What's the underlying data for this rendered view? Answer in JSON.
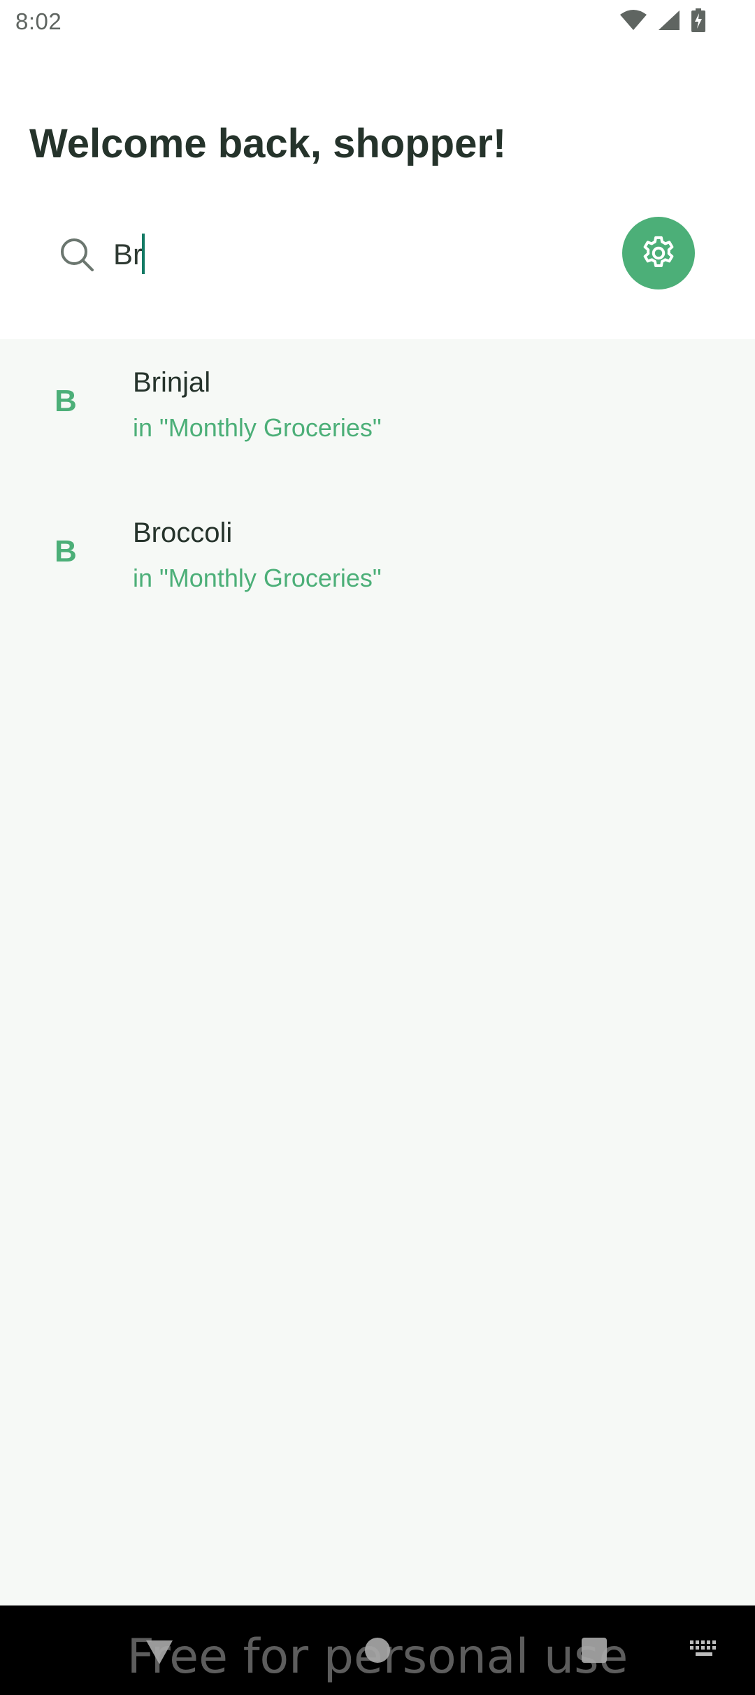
{
  "status_bar": {
    "time": "8:02",
    "icons": [
      "wifi-icon",
      "signal-icon",
      "battery-charging-icon"
    ]
  },
  "header": {
    "greeting": "Welcome back, shopper!"
  },
  "search": {
    "value": "Br",
    "icon": "search-icon",
    "settings_icon": "gear-icon"
  },
  "results": [
    {
      "initial": "B",
      "name": "Brinjal",
      "list": "in \"Monthly Groceries\""
    },
    {
      "initial": "B",
      "name": "Broccoli",
      "list": "in \"Monthly Groceries\""
    }
  ],
  "nav_bar": {
    "icons": [
      "back-icon",
      "home-icon",
      "recents-icon",
      "keyboard-icon"
    ]
  },
  "watermark": "Free for personal use",
  "colors": {
    "accent": "#4caf78",
    "text_dark": "#25332b",
    "results_bg": "#f6f9f6",
    "caret": "#137a64"
  }
}
